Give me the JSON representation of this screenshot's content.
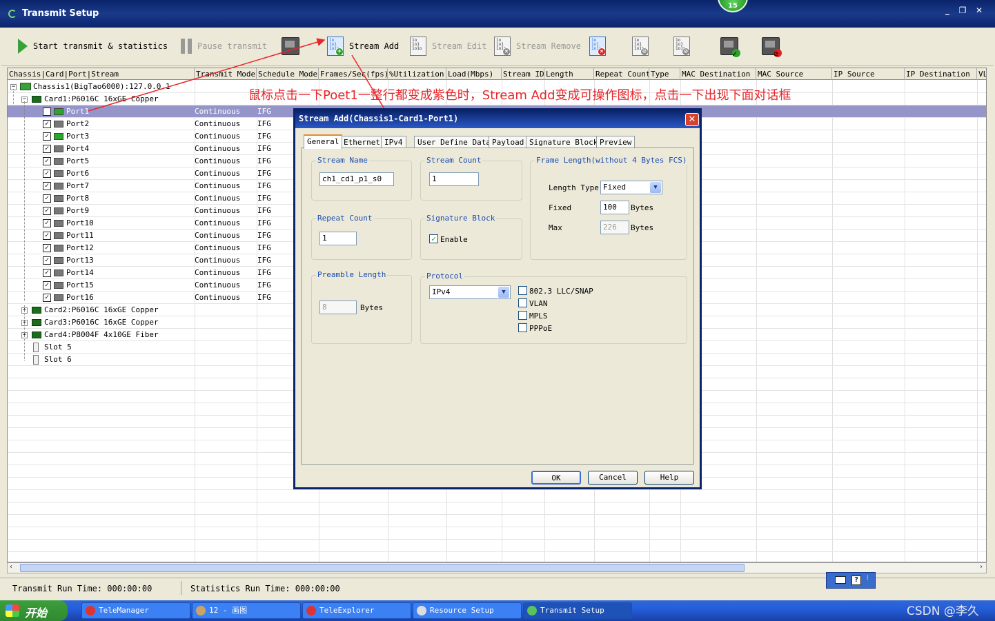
{
  "window": {
    "title": "Transmit Setup",
    "badge": "15"
  },
  "toolbar": {
    "start_label": "Start transmit & statistics",
    "pause_label": "Pause transmit",
    "stream_add_label": "Stream Add",
    "stream_edit_label": "Stream Edit",
    "stream_remove_label": "Stream Remove"
  },
  "grid": {
    "columns": [
      "Chassis|Card|Port|Stream",
      "Transmit Mode",
      "Schedule Mode",
      "Frames/Sec(fps)",
      "%Utilization",
      "Load(Mbps)",
      "Stream ID",
      "Length",
      "Repeat Count",
      "Type",
      "MAC Destination",
      "MAC Source",
      "IP Source",
      "IP Destination",
      "VL"
    ],
    "chassis": "Chassis1(BigTao6000):127.0.0.1",
    "card1": "Card1:P6016C 16xGE Copper",
    "ports": [
      "Port1",
      "Port2",
      "Port3",
      "Port4",
      "Port5",
      "Port6",
      "Port7",
      "Port8",
      "Port9",
      "Port10",
      "Port11",
      "Port12",
      "Port13",
      "Port14",
      "Port15",
      "Port16"
    ],
    "transmit_mode": "Continuous",
    "schedule_mode": "IFG",
    "card2": "Card2:P6016C 16xGE Copper",
    "card3": "Card3:P6016C 16xGE Copper",
    "card4": "Card4:P8004F 4x10GE Fiber",
    "slot5": "Slot 5",
    "slot6": "Slot 6"
  },
  "annotation": "鼠标点击一下Poet1一整行都变成紫色时，Stream Add变成可操作图标，点击一下出现下面对话框",
  "status": {
    "transmit_run_time": "Transmit Run Time: 000:00:00",
    "statistics_run_time": "Statistics Run Time: 000:00:00"
  },
  "dialog": {
    "title": "Stream Add(Chassis1-Card1-Port1)",
    "tabs": [
      "General",
      "Ethernet",
      "IPv4",
      "User Define Data",
      "Payload",
      "Signature Block",
      "Preview"
    ],
    "stream_name_label": "Stream Name",
    "stream_name_value": "ch1_cd1_p1_s0",
    "stream_count_label": "Stream Count",
    "stream_count_value": "1",
    "frame_length_label": "Frame Length(without 4 Bytes FCS)",
    "length_type_label": "Length Type",
    "length_type_value": "Fixed",
    "fixed_label": "Fixed",
    "fixed_value": "100",
    "max_label": "Max",
    "max_value": "226",
    "bytes_label": "Bytes",
    "repeat_count_label": "Repeat Count",
    "repeat_count_value": "1",
    "signature_block_label": "Signature Block",
    "enable_label": "Enable",
    "preamble_length_label": "Preamble Length",
    "preamble_length_value": "8",
    "protocol_label": "Protocol",
    "protocol_value": "IPv4",
    "protocol_options": [
      "802.3 LLC/SNAP",
      "VLAN",
      "MPLS",
      "PPPoE"
    ],
    "ok_label": "OK",
    "cancel_label": "Cancel",
    "help_label": "Help"
  },
  "taskbar": {
    "start_label": "开始",
    "items": [
      "TeleManager",
      "12 - 画图",
      "TeleExplorer",
      "Resource Setup",
      "Transmit Setup"
    ]
  },
  "watermark": "CSDN @李久",
  "colors": {
    "titlebar": "#0A246A",
    "selected_row": "#9595C9",
    "annotation": "#E8262A",
    "taskbar": "#245EDB"
  }
}
